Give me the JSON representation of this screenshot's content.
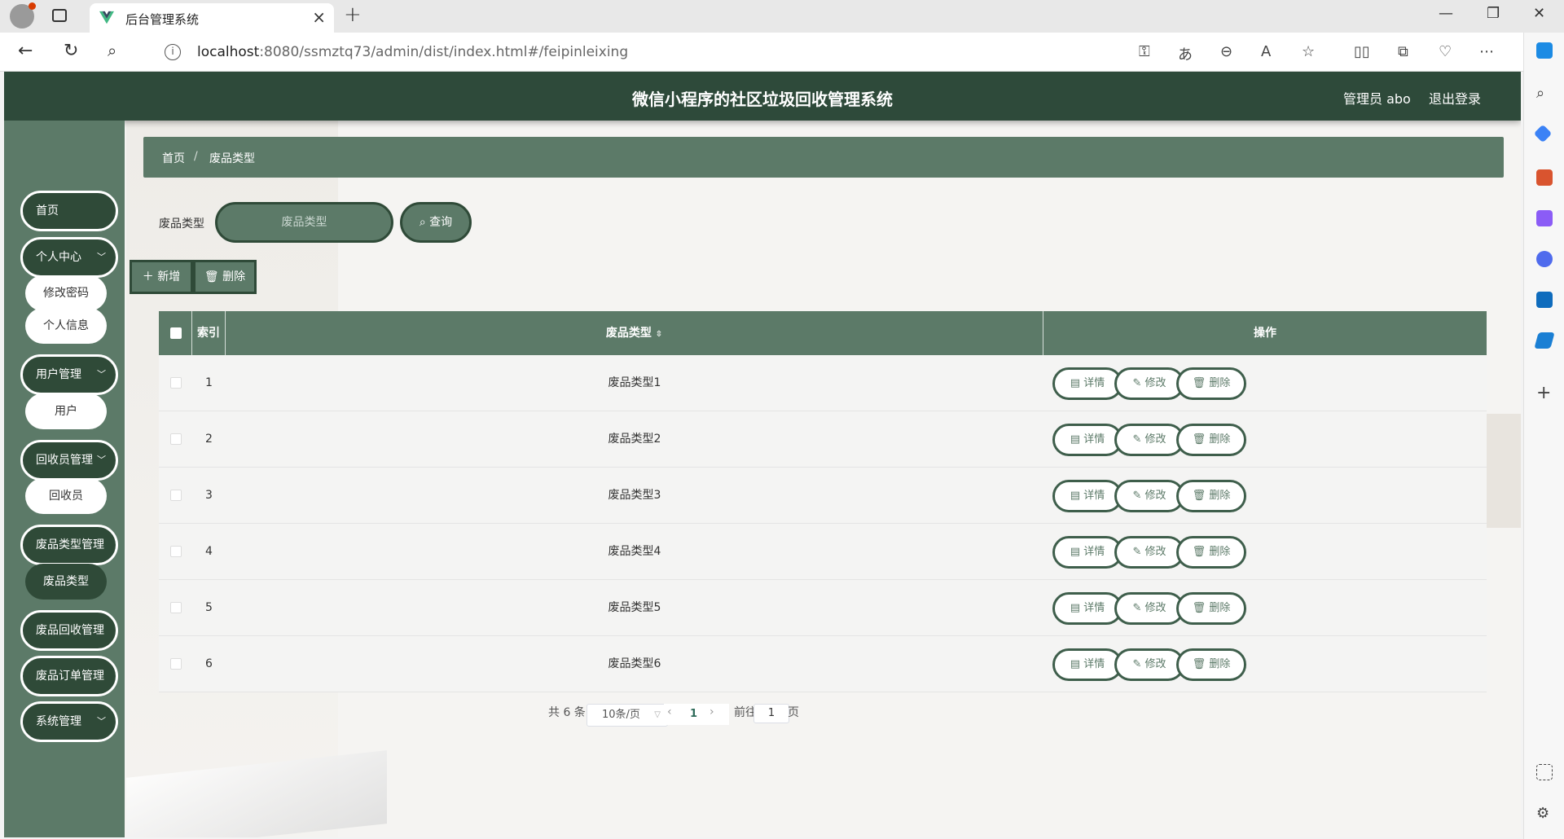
{
  "browser": {
    "tab_title": "后台管理系统",
    "url_host": "localhost",
    "url_rest": ":8080/ssmztq73/admin/dist/index.html#/feipinleixing"
  },
  "header": {
    "title": "微信小程序的社区垃圾回收管理系统",
    "user": "管理员 abo",
    "logout": "退出登录"
  },
  "sidebar": {
    "home": "首页",
    "personal": "个人中心",
    "change_password": "修改密码",
    "personal_info": "个人信息",
    "user_mgmt": "用户管理",
    "user": "用户",
    "recycler_mgmt": "回收员管理",
    "recycler": "回收员",
    "waste_type_mgmt": "废品类型管理",
    "waste_type": "废品类型",
    "waste_recycle_mgmt": "废品回收管理",
    "waste_order_mgmt": "废品订单管理",
    "system_mgmt": "系统管理"
  },
  "breadcrumb": {
    "home": "首页",
    "sep": "/",
    "current": "废品类型"
  },
  "search": {
    "label": "废品类型",
    "placeholder": "废品类型",
    "button": "查询"
  },
  "actions": {
    "add": "新增",
    "delete": "删除"
  },
  "table": {
    "col_index": "索引",
    "col_type": "废品类型",
    "col_ops": "操作",
    "op_detail": "详情",
    "op_edit": "修改",
    "op_delete": "删除",
    "rows": [
      {
        "index": "1",
        "type": "废品类型1"
      },
      {
        "index": "2",
        "type": "废品类型2"
      },
      {
        "index": "3",
        "type": "废品类型3"
      },
      {
        "index": "4",
        "type": "废品类型4"
      },
      {
        "index": "5",
        "type": "废品类型5"
      },
      {
        "index": "6",
        "type": "废品类型6"
      }
    ]
  },
  "pagination": {
    "total": "共 6 条",
    "page_size": "10条/页",
    "current_page": "1",
    "goto_label": "前往",
    "goto_value": "1",
    "page_unit": "页"
  },
  "colors": {
    "header": "#2e4a3a",
    "sidebar": "#5c7a68",
    "accent": "#2f4a38"
  }
}
